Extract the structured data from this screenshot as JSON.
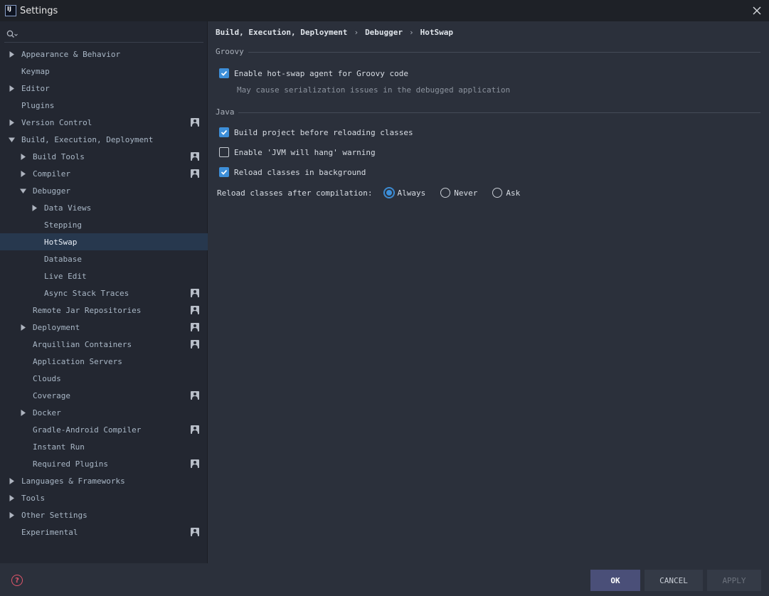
{
  "window": {
    "title": "Settings",
    "logo_text": "IJ"
  },
  "search": {
    "placeholder": ""
  },
  "sidebar": {
    "items": [
      {
        "label": "Appearance & Behavior",
        "level": 0,
        "arrow": "right",
        "project": false,
        "selected": false
      },
      {
        "label": "Keymap",
        "level": 0,
        "arrow": "none",
        "project": false,
        "selected": false
      },
      {
        "label": "Editor",
        "level": 0,
        "arrow": "right",
        "project": false,
        "selected": false
      },
      {
        "label": "Plugins",
        "level": 0,
        "arrow": "none",
        "project": false,
        "selected": false
      },
      {
        "label": "Version Control",
        "level": 0,
        "arrow": "right",
        "project": true,
        "selected": false
      },
      {
        "label": "Build, Execution, Deployment",
        "level": 0,
        "arrow": "down",
        "project": false,
        "selected": false
      },
      {
        "label": "Build Tools",
        "level": 1,
        "arrow": "right",
        "project": true,
        "selected": false
      },
      {
        "label": "Compiler",
        "level": 1,
        "arrow": "right",
        "project": true,
        "selected": false
      },
      {
        "label": "Debugger",
        "level": 1,
        "arrow": "down",
        "project": false,
        "selected": false
      },
      {
        "label": "Data Views",
        "level": 2,
        "arrow": "right",
        "project": false,
        "selected": false
      },
      {
        "label": "Stepping",
        "level": 2,
        "arrow": "none",
        "project": false,
        "selected": false
      },
      {
        "label": "HotSwap",
        "level": 2,
        "arrow": "none",
        "project": false,
        "selected": true
      },
      {
        "label": "Database",
        "level": 2,
        "arrow": "none",
        "project": false,
        "selected": false
      },
      {
        "label": "Live Edit",
        "level": 2,
        "arrow": "none",
        "project": false,
        "selected": false
      },
      {
        "label": "Async Stack Traces",
        "level": 2,
        "arrow": "none",
        "project": true,
        "selected": false
      },
      {
        "label": "Remote Jar Repositories",
        "level": 1,
        "arrow": "none",
        "project": true,
        "selected": false
      },
      {
        "label": "Deployment",
        "level": 1,
        "arrow": "right",
        "project": true,
        "selected": false
      },
      {
        "label": "Arquillian Containers",
        "level": 1,
        "arrow": "none",
        "project": true,
        "selected": false
      },
      {
        "label": "Application Servers",
        "level": 1,
        "arrow": "none",
        "project": false,
        "selected": false
      },
      {
        "label": "Clouds",
        "level": 1,
        "arrow": "none",
        "project": false,
        "selected": false
      },
      {
        "label": "Coverage",
        "level": 1,
        "arrow": "none",
        "project": true,
        "selected": false
      },
      {
        "label": "Docker",
        "level": 1,
        "arrow": "right",
        "project": false,
        "selected": false
      },
      {
        "label": "Gradle-Android Compiler",
        "level": 1,
        "arrow": "none",
        "project": true,
        "selected": false
      },
      {
        "label": "Instant Run",
        "level": 1,
        "arrow": "none",
        "project": false,
        "selected": false
      },
      {
        "label": "Required Plugins",
        "level": 1,
        "arrow": "none",
        "project": true,
        "selected": false
      },
      {
        "label": "Languages & Frameworks",
        "level": 0,
        "arrow": "right",
        "project": false,
        "selected": false
      },
      {
        "label": "Tools",
        "level": 0,
        "arrow": "right",
        "project": false,
        "selected": false
      },
      {
        "label": "Other Settings",
        "level": 0,
        "arrow": "right",
        "project": false,
        "selected": false
      },
      {
        "label": "Experimental",
        "level": 0,
        "arrow": "none",
        "project": true,
        "selected": false
      }
    ]
  },
  "breadcrumb": {
    "items": [
      "Build, Execution, Deployment",
      "Debugger",
      "HotSwap"
    ],
    "separator": "›"
  },
  "groovy": {
    "title": "Groovy",
    "hotswap_agent": {
      "label": "Enable hot-swap agent for Groovy code",
      "checked": true
    },
    "hint": "May cause serialization issues in the debugged application"
  },
  "java": {
    "title": "Java",
    "build_before_reload": {
      "label": "Build project before reloading classes",
      "checked": true
    },
    "jvm_hang_warning": {
      "label": "Enable 'JVM will hang' warning",
      "checked": false
    },
    "reload_background": {
      "label": "Reload classes in background",
      "checked": true
    }
  },
  "reload_after_compilation": {
    "label": "Reload classes after compilation:",
    "options": [
      {
        "label": "Always",
        "selected": true
      },
      {
        "label": "Never",
        "selected": false
      },
      {
        "label": "Ask",
        "selected": false
      }
    ]
  },
  "footer": {
    "help_glyph": "?",
    "ok_label": "OK",
    "cancel_label": "CANCEL",
    "apply_label": "APPLY"
  },
  "colors": {
    "accent": "#3d8fd9",
    "selection": "#27384e",
    "ok_button": "#4a4f78",
    "help": "#e0566b"
  }
}
